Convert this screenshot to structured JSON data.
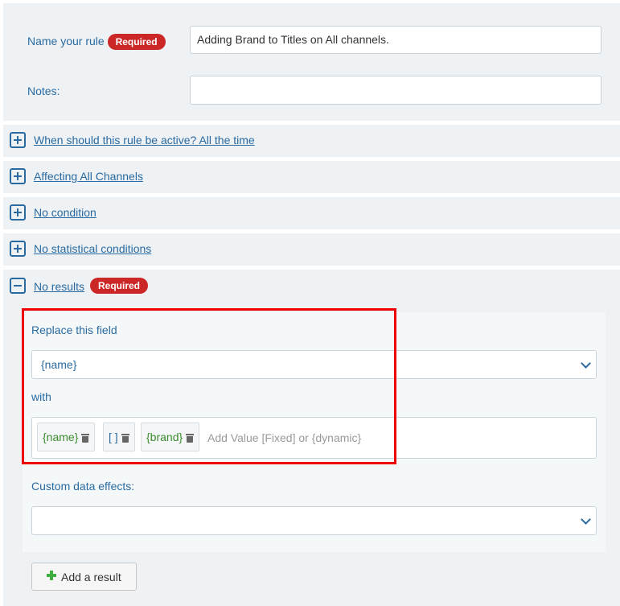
{
  "rule": {
    "name_label": "Name your rule",
    "required_badge": "Required",
    "name_value": "Adding Brand to Titles on All channels.",
    "notes_label": "Notes:",
    "notes_value": ""
  },
  "sections": [
    {
      "label": "When should this rule be active? All the time",
      "state": "collapsed"
    },
    {
      "label": "Affecting All Channels",
      "state": "collapsed"
    },
    {
      "label": "No condition",
      "state": "collapsed"
    },
    {
      "label": "No statistical conditions",
      "state": "collapsed"
    },
    {
      "label": "No results",
      "state": "expanded",
      "badge": "Required"
    }
  ],
  "results": {
    "replace_label": "Replace this field",
    "replace_value": "{name}",
    "with_label": "with",
    "chips": [
      {
        "text": "{name}",
        "kind": "dynamic"
      },
      {
        "text": "[ ]",
        "kind": "fixed"
      },
      {
        "text": "{brand}",
        "kind": "dynamic"
      }
    ],
    "add_value_placeholder": "Add Value [Fixed] or {dynamic}",
    "custom_effects_label": "Custom data effects:",
    "custom_effects_value": ""
  },
  "add_result_button": "Add a result",
  "colors": {
    "accent": "#2a6aa0",
    "required_badge": "#cc2727",
    "dynamic_chip_text": "#3b8b2e",
    "highlight": "#ee0000",
    "panel_bg": "#eef2f5"
  },
  "icons": {
    "collapsed": "plus-square-icon",
    "expanded": "minus-square-icon",
    "chip_remove": "trash-icon",
    "select": "chevron-down-icon",
    "add": "green-plus-icon"
  }
}
